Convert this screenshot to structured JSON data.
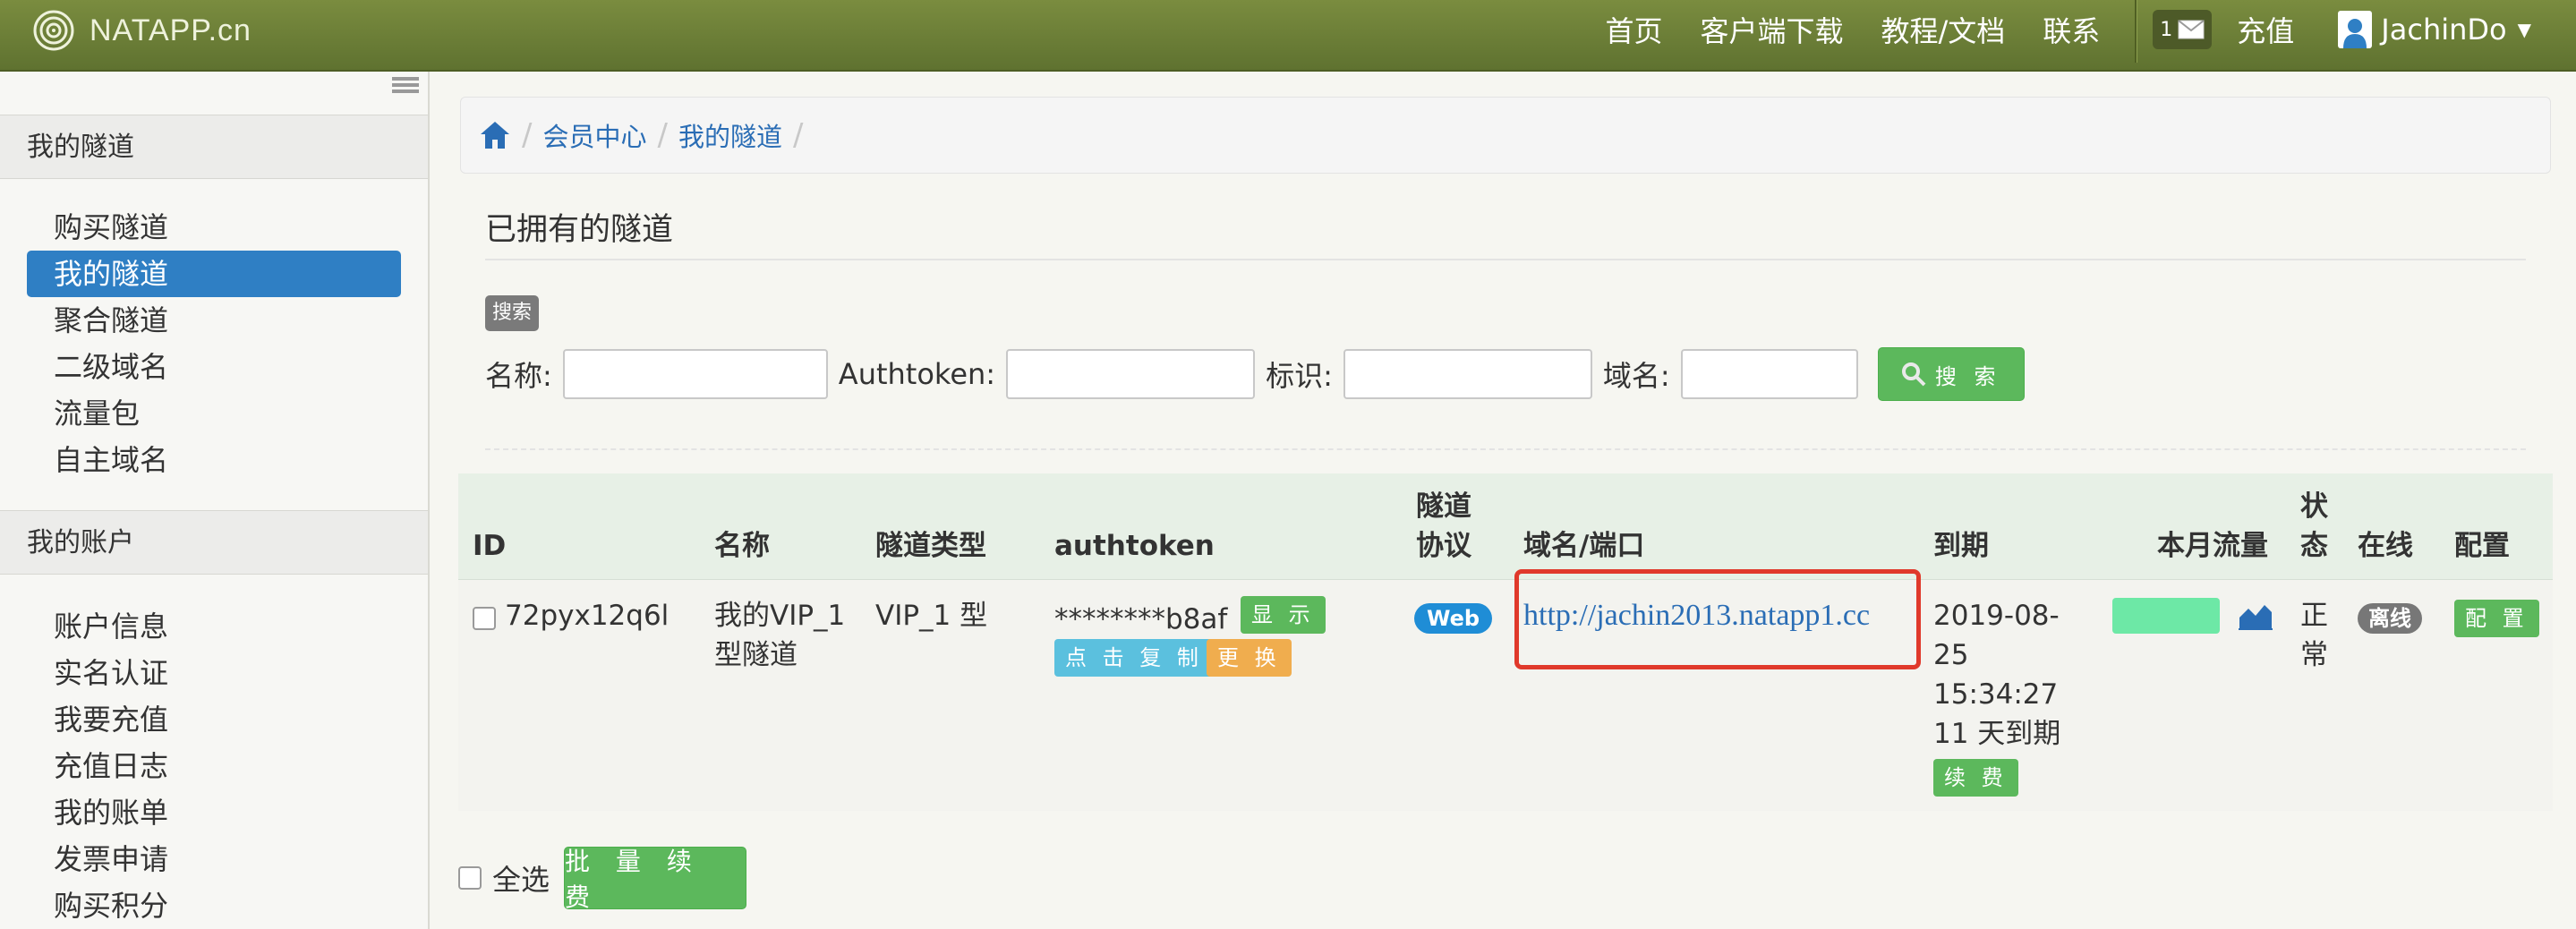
{
  "navbar": {
    "brand": "NATAPP.cn",
    "links": [
      "首页",
      "客户端下载",
      "教程/文档",
      "联系"
    ],
    "mail_count": "1",
    "recharge": "充值",
    "username": "JachinDo"
  },
  "sidebar": {
    "section1": "我的隧道",
    "section1_items": [
      "购买隧道",
      "我的隧道",
      "聚合隧道",
      "二级域名",
      "流量包",
      "自主域名"
    ],
    "section2": "我的账户",
    "section2_items": [
      "账户信息",
      "实名认证",
      "我要充值",
      "充值日志",
      "我的账单",
      "发票申请",
      "购买积分"
    ]
  },
  "breadcrumb": [
    "会员中心",
    "我的隧道"
  ],
  "page_title": "已拥有的隧道",
  "search": {
    "tag": "搜索",
    "name_label": "名称:",
    "authtoken_label": "Authtoken:",
    "mark_label": "标识:",
    "domain_label": "域名:",
    "button": "搜 索"
  },
  "table": {
    "headers": {
      "id": "ID",
      "name": "名称",
      "type": "隧道类型",
      "authtoken": "authtoken",
      "protocol_1": "隧道",
      "protocol_2": "协议",
      "domain": "域名/端口",
      "expire": "到期",
      "traffic": "本月流量",
      "status_1": "状",
      "status_2": "态",
      "online": "在线",
      "config": "配置"
    },
    "row": {
      "id": "72pyx12q6l",
      "name_1": "我的VIP_1",
      "name_2": "型隧道",
      "type": "VIP_1 型",
      "authtoken": "********b8af",
      "show_btn": "显 示",
      "copy_btn": "点 击 复 制",
      "change_btn": "更 换",
      "protocol": "Web",
      "domain": "http://jachin2013.natapp1.cc",
      "expire_date": "2019-08-",
      "expire_day": "25",
      "expire_time": "15:34:27",
      "expire_days_left": "11 天到期",
      "renew_btn": "续 费",
      "status_1": "正",
      "status_2": "常",
      "online": "离线",
      "config_btn": "配 置"
    }
  },
  "footer": {
    "select_all": "全选",
    "batch_renew": "批 量 续 费"
  },
  "colors": {
    "navbar": "#6b7d36",
    "active": "#2f7fc4",
    "success": "#5cb85c",
    "info": "#5bc0de",
    "warning": "#f0ad4e",
    "highlight": "#e0392b"
  }
}
